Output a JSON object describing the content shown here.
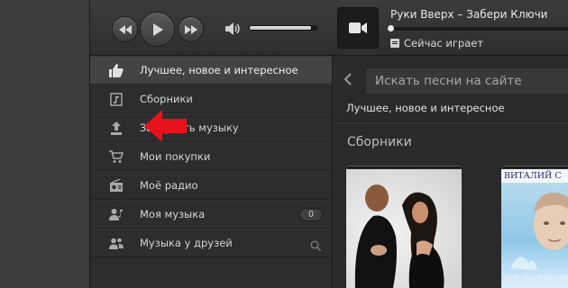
{
  "player": {
    "controls": {
      "prev_icon": "rewind-icon",
      "play_icon": "play-icon",
      "next_icon": "fast-forward-icon"
    },
    "volume": {
      "icon": "speaker-icon",
      "level": 0.92
    },
    "track": {
      "art_icon": "video-camera-icon",
      "title": "Руки Вверх – Забери Ключи",
      "progress": 0.0,
      "status_icon": "list-icon",
      "status": "Сейчас играет"
    }
  },
  "sidebar": {
    "items": [
      {
        "label": "Лучшее, новое и интересное",
        "icon": "thumbs-up-icon",
        "active": true
      },
      {
        "label": "Сборники",
        "icon": "music-collection-icon"
      },
      {
        "label": "Загрузить музыку",
        "icon": "upload-icon"
      },
      {
        "label": "Мои покупки",
        "icon": "cart-icon"
      },
      {
        "label": "Моё радио",
        "icon": "radio-icon"
      },
      {
        "label": "Моя музыка",
        "icon": "user-music-icon",
        "badge": "0"
      },
      {
        "label": "Музыка у друзей",
        "icon": "friends-icon",
        "trailing_icon": "search-icon"
      }
    ]
  },
  "main": {
    "search_placeholder": "Искать песни на сайте",
    "breadcrumb": "Лучшее, новое и интересное",
    "section_title": "Сборники",
    "albums": [
      {
        "cover_title": "",
        "cover_subtitle": ""
      },
      {
        "cover_title": "ВИТАЛИЙ С",
        "cover_subtitle": "БОГ ПО ИМЕНИ"
      }
    ]
  },
  "colors": {
    "annotation_arrow": "#e8121c",
    "active_item_bg": "#434343",
    "window_bg": "#2b2b2b"
  }
}
